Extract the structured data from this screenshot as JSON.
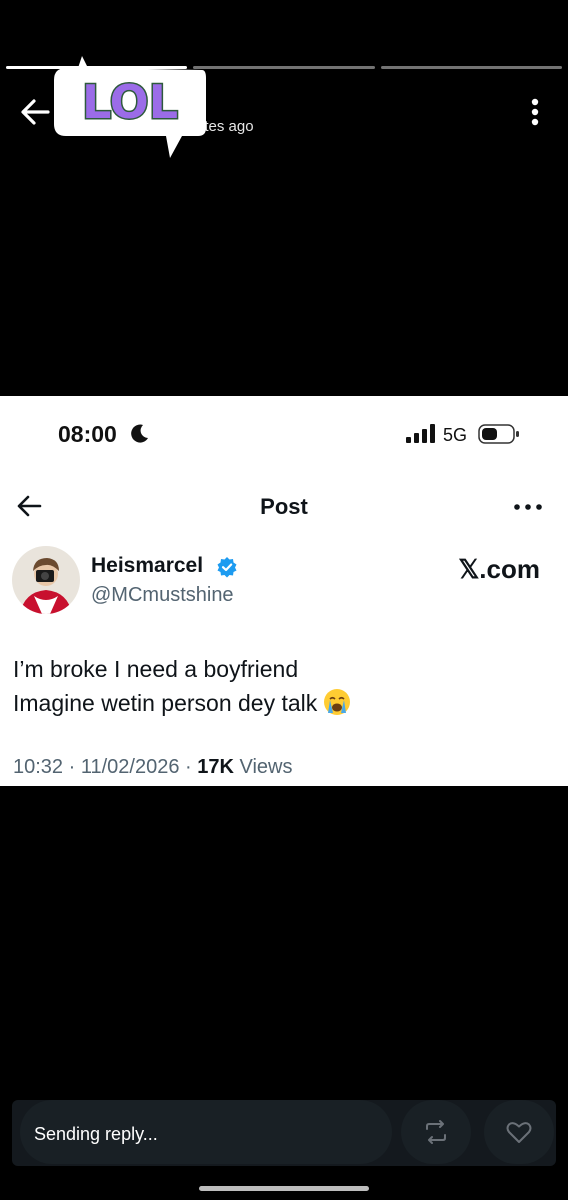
{
  "story": {
    "time_ago": "utes ago",
    "progress": {
      "segments": 3,
      "active_index": 0
    }
  },
  "sticker": {
    "text": "LOL"
  },
  "screenshot": {
    "status_bar": {
      "time": "08:00",
      "network": "5G"
    },
    "header": {
      "title": "Post"
    },
    "author": {
      "name": "Heismarcel",
      "handle": "@MCmustshine",
      "verified": true
    },
    "watermark": "𝕏.com",
    "tweet": {
      "line1": "I’m broke I need a boyfriend",
      "line2": "Imagine wetin person dey talk"
    },
    "meta": {
      "time": "10:32",
      "sep1": " · ",
      "date": "11/02/2026",
      "sep2": " · ",
      "views_count": "17K",
      "views_label": " Views"
    }
  },
  "reply_bar": {
    "status_text": "Sending reply..."
  },
  "colors": {
    "accent_blue": "#1d9bf0",
    "sticker_purple": "#9b6ce8",
    "sticker_green": "#2e5a3c"
  }
}
